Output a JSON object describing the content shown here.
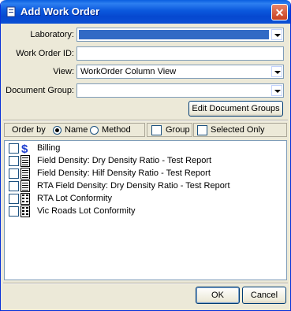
{
  "window": {
    "title": "Add Work Order",
    "close": "✕"
  },
  "form": {
    "laboratory_label": "Laboratory:",
    "laboratory_value": "",
    "work_order_id_label": "Work Order ID:",
    "work_order_id_value": "",
    "view_label": "View:",
    "view_value": "WorkOrder Column View",
    "document_group_label": "Document Group:",
    "document_group_value": "",
    "edit_groups_button": "Edit Document Groups"
  },
  "order_bar": {
    "order_by_label": "Order by",
    "name_label": "Name",
    "method_label": "Method",
    "selected_order": "Name",
    "group_label": "Group",
    "selected_only_label": "Selected Only"
  },
  "documents": [
    {
      "label": "Billing",
      "icon": "dollar-icon",
      "checked": false
    },
    {
      "label": "Field Density: Dry Density Ratio - Test Report",
      "icon": "document-icon",
      "checked": false
    },
    {
      "label": "Field Density: Hilf Density Ratio - Test Report",
      "icon": "document-icon",
      "checked": false
    },
    {
      "label": "RTA Field Density: Dry Density Ratio - Test Report",
      "icon": "document-icon",
      "checked": false
    },
    {
      "label": "RTA Lot Conformity",
      "icon": "grid-document-icon",
      "checked": false
    },
    {
      "label": "Vic Roads Lot Conformity",
      "icon": "grid-document-icon",
      "checked": false
    }
  ],
  "footer": {
    "ok": "OK",
    "cancel": "Cancel"
  },
  "colors": {
    "titlebar": "#0a5ee0",
    "dialog_bg": "#ece9d8",
    "selection": "#316ac5",
    "dollar": "#1f3fd0"
  }
}
